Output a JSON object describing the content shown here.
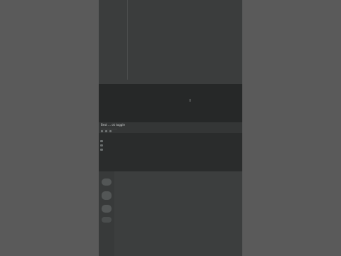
{
  "video": {
    "title": "Best ... ok toggle",
    "subtitle": "........................"
  },
  "colors": {
    "page_background": "#5a5a5a",
    "player_band": "#262828",
    "panel": "#2a2c2c",
    "frame": "#3a3c3c"
  },
  "toolbar_icons": [
    "play-icon",
    "volume-icon",
    "settings-icon"
  ],
  "sidebar_icons": [
    "home-icon",
    "explore-icon",
    "library-icon"
  ],
  "thumbnail_icons": [
    "thumbnail-icon",
    "thumbnail-icon",
    "thumbnail-icon",
    "thumbnail-icon"
  ]
}
